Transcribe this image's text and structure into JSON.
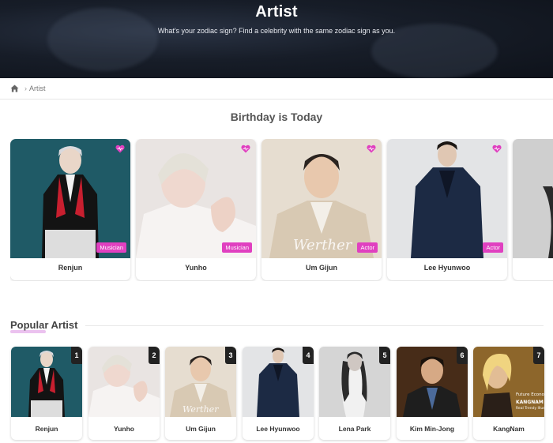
{
  "header": {
    "title": "Artist",
    "subtitle": "What's your zodiac sign? Find a celebrity with the same zodiac sign as you."
  },
  "breadcrumb": {
    "home_icon": "home-icon",
    "separator": "›",
    "current": "Artist"
  },
  "birthday": {
    "title": "Birthday is Today",
    "cards": [
      {
        "name": "Renjun",
        "category": "Musician",
        "liked": true
      },
      {
        "name": "Yunho",
        "category": "Musician",
        "liked": true
      },
      {
        "name": "Um Gijun",
        "category": "Actor",
        "liked": true
      },
      {
        "name": "Lee Hyunwoo",
        "category": "Actor",
        "liked": true
      }
    ]
  },
  "popular": {
    "title": "Popular Artist",
    "cards": [
      {
        "rank": "1",
        "name": "Renjun"
      },
      {
        "rank": "2",
        "name": "Yunho"
      },
      {
        "rank": "3",
        "name": "Um Gijun"
      },
      {
        "rank": "4",
        "name": "Lee Hyunwoo"
      },
      {
        "rank": "5",
        "name": "Lena Park"
      },
      {
        "rank": "6",
        "name": "Kim Min-Jong"
      },
      {
        "rank": "7",
        "name": "KangNam"
      }
    ]
  },
  "colors": {
    "badge": "#e040c0",
    "heart": "#e040c0",
    "rank_bg": "#222222"
  }
}
